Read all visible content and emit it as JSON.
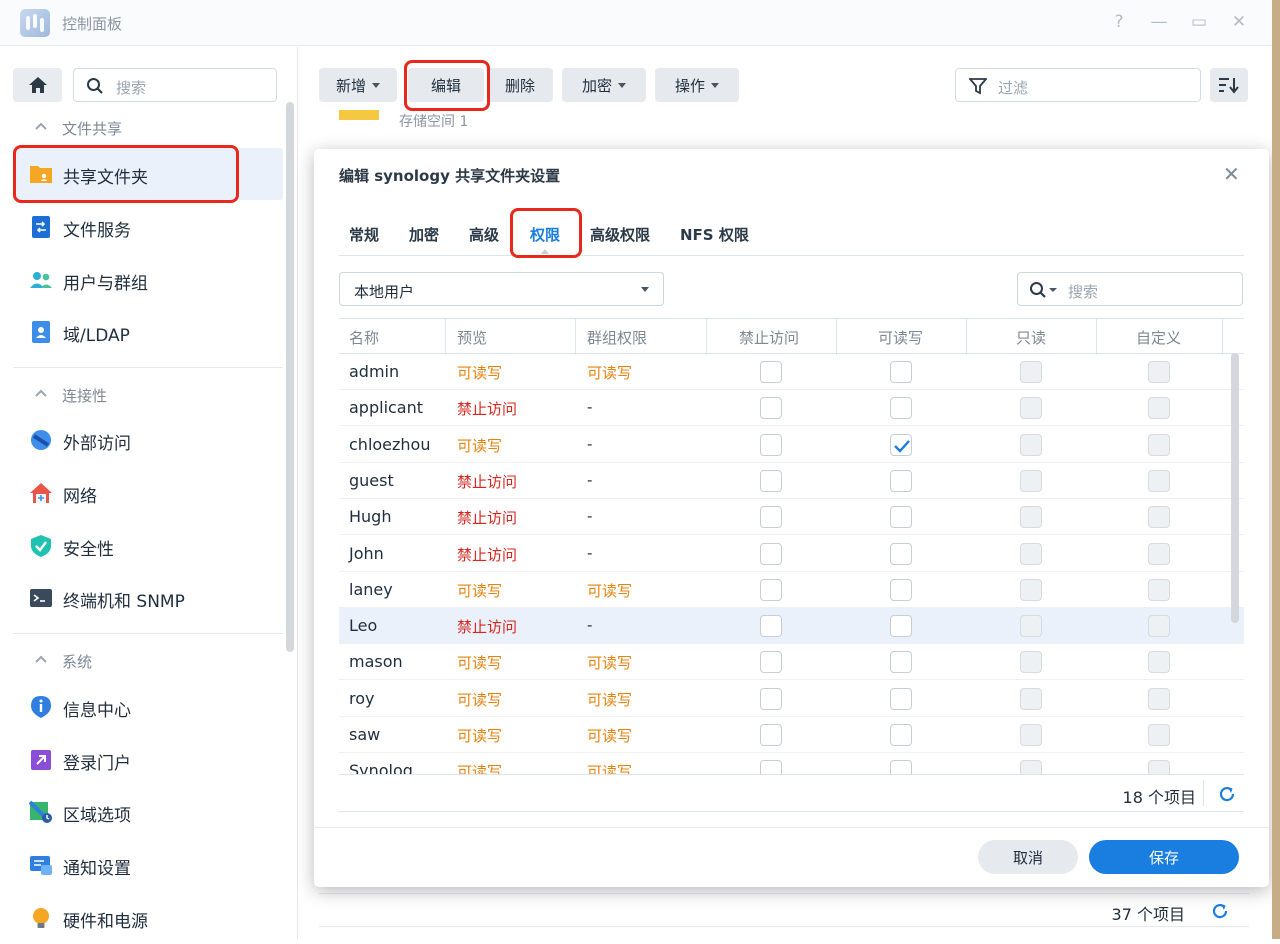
{
  "window": {
    "title": "控制面板",
    "help": "?",
    "minimize": "—",
    "maximize": "▭",
    "close": "✕"
  },
  "sidebar": {
    "search_placeholder": "搜索",
    "sections": [
      {
        "label": "文件共享",
        "items": [
          "共享文件夹",
          "文件服务",
          "用户与群组",
          "域/LDAP"
        ]
      },
      {
        "label": "连接性",
        "items": [
          "外部访问",
          "网络",
          "安全性",
          "终端机和 SNMP"
        ]
      },
      {
        "label": "系统",
        "items": [
          "信息中心",
          "登录门户",
          "区域选项",
          "通知设置",
          "硬件和电源"
        ]
      }
    ],
    "active_item": "共享文件夹"
  },
  "toolbar": {
    "add": "新增",
    "edit": "编辑",
    "delete": "删除",
    "encrypt": "加密",
    "action": "操作",
    "filter_placeholder": "过滤"
  },
  "background": {
    "row_text": "存储空间 1",
    "count": "37 个项目"
  },
  "dialog": {
    "title": "编辑 synology 共享文件夹设置",
    "tabs": [
      "常规",
      "加密",
      "高级",
      "权限",
      "高级权限",
      "NFS 权限"
    ],
    "active_tab": "权限",
    "user_type": "本地用户",
    "search_placeholder": "搜索",
    "columns": [
      "名称",
      "预览",
      "群组权限",
      "禁止访问",
      "可读写",
      "只读",
      "自定义"
    ],
    "rows": [
      {
        "name": "admin",
        "preview": "可读写",
        "group": "可读写",
        "deny": false,
        "rw": false,
        "ro": false,
        "custom": false,
        "disabled": true
      },
      {
        "name": "applicant",
        "preview": "禁止访问",
        "group": "-",
        "deny": false,
        "rw": false,
        "ro": false,
        "custom": false,
        "disabled": false
      },
      {
        "name": "chloezhou",
        "preview": "可读写",
        "group": "-",
        "deny": false,
        "rw": true,
        "ro": false,
        "custom": false,
        "disabled": false
      },
      {
        "name": "guest",
        "preview": "禁止访问",
        "group": "-",
        "deny": false,
        "rw": false,
        "ro": false,
        "custom": false,
        "disabled": false
      },
      {
        "name": "Hugh",
        "preview": "禁止访问",
        "group": "-",
        "deny": false,
        "rw": false,
        "ro": false,
        "custom": false,
        "disabled": false
      },
      {
        "name": "John",
        "preview": "禁止访问",
        "group": "-",
        "deny": false,
        "rw": false,
        "ro": false,
        "custom": false,
        "disabled": false
      },
      {
        "name": "laney",
        "preview": "可读写",
        "group": "可读写",
        "deny": false,
        "rw": false,
        "ro": false,
        "custom": false,
        "disabled": true
      },
      {
        "name": "Leo",
        "preview": "禁止访问",
        "group": "-",
        "deny": false,
        "rw": false,
        "ro": false,
        "custom": false,
        "disabled": false,
        "highlight": true
      },
      {
        "name": "mason",
        "preview": "可读写",
        "group": "可读写",
        "deny": false,
        "rw": false,
        "ro": false,
        "custom": false,
        "disabled": true
      },
      {
        "name": "roy",
        "preview": "可读写",
        "group": "可读写",
        "deny": false,
        "rw": false,
        "ro": false,
        "custom": false,
        "disabled": true
      },
      {
        "name": "saw",
        "preview": "可读写",
        "group": "可读写",
        "deny": false,
        "rw": false,
        "ro": false,
        "custom": false,
        "disabled": true
      },
      {
        "name": "Synolog",
        "preview": "可读写",
        "group": "可读写",
        "deny": false,
        "rw": false,
        "ro": false,
        "custom": false,
        "disabled": true
      }
    ],
    "count": "18 个项目",
    "cancel": "取消",
    "save": "保存"
  },
  "colors": {
    "accent": "#1a7de0",
    "rw": "#e8820c",
    "deny": "#d8261c",
    "highlight_box": "#e8281c"
  }
}
